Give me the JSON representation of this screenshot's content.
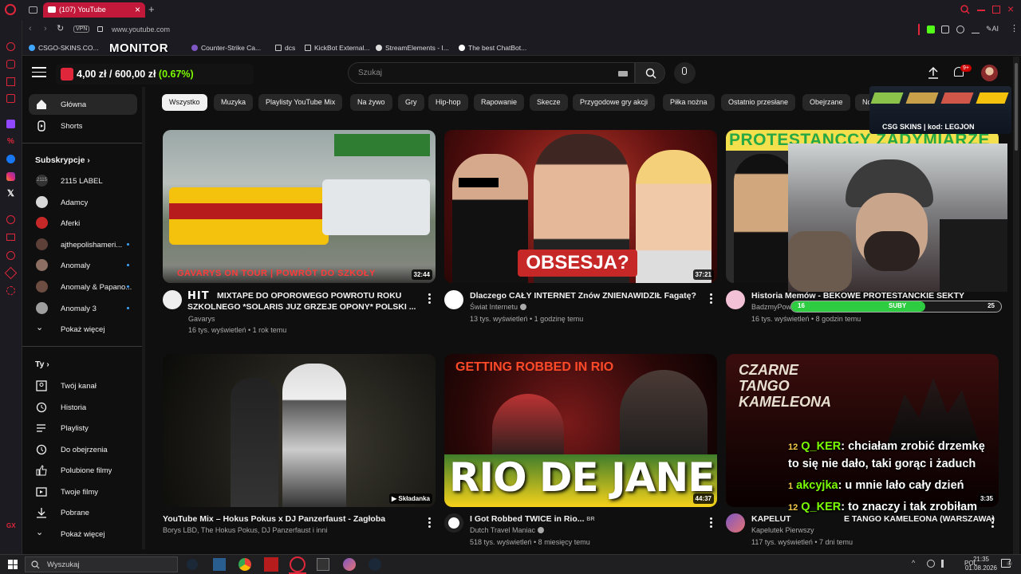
{
  "browser": {
    "tab_title": "(107) YouTube",
    "url": "www.youtube.com",
    "vpn_label": "VPN",
    "ai_label": "AI",
    "bookmarks": [
      "CSGO-SKINS.CO...",
      "Counter-Strike Ca...",
      "dcs",
      "KickBot External...",
      "StreamElements - I...",
      "The best ChatBot..."
    ]
  },
  "overlay": {
    "monitor_label": "MONITOR",
    "goal_current": "4,00 zł",
    "goal_sep": "/",
    "goal_target": "600,00 zł",
    "goal_percent": "(0.67%)",
    "promo_text": "CSG  SKINS | kod: LEGJON",
    "sub_bar_label": "SUBY",
    "sub_bar_current": "16",
    "sub_bar_target": "25",
    "sub_bar_progress": 0.64,
    "chat": [
      {
        "user": "Q_KER",
        "msg": ": chciałam zrobić drzemkę"
      },
      {
        "user": "",
        "msg": "to się nie dało, taki gorąc i żaduch"
      },
      {
        "user": "akcyjka",
        "msg": ": u mnie lało cały dzień"
      },
      {
        "user": "Q_KER",
        "msg": ": to znaczy i tak zrobiłam"
      }
    ],
    "chat_badges": [
      "12",
      "1",
      "1",
      "12"
    ]
  },
  "youtube": {
    "search_placeholder": "Szukaj",
    "notif_count": "9+",
    "guide": {
      "main": [
        {
          "label": "Główna",
          "icon": "home-icon"
        },
        {
          "label": "Shorts",
          "icon": "shorts-icon"
        }
      ],
      "subs_header": "Subskrypcje",
      "subs": [
        {
          "label": "2115 LABEL",
          "color": "#333333",
          "dot": false
        },
        {
          "label": "Adamcy",
          "color": "#d8d8d8",
          "dot": false
        },
        {
          "label": "Aferki",
          "color": "#c62828",
          "dot": false
        },
        {
          "label": "ajthepolishameri...",
          "color": "#5d4037",
          "dot": true
        },
        {
          "label": "Anomaly",
          "color": "#8d6e63",
          "dot": true
        },
        {
          "label": "Anomaly & Papano...",
          "color": "#6d4c41",
          "dot": true
        },
        {
          "label": "Anomaly 3",
          "color": "#9e9e9e",
          "dot": true
        }
      ],
      "subs_more": "Pokaż więcej",
      "you_header": "Ty",
      "you": [
        {
          "label": "Twój kanał",
          "icon": "channel-icon"
        },
        {
          "label": "Historia",
          "icon": "history-icon"
        },
        {
          "label": "Playlisty",
          "icon": "playlist-icon"
        },
        {
          "label": "Do obejrzenia",
          "icon": "watch-later-icon"
        },
        {
          "label": "Polubione filmy",
          "icon": "like-icon"
        },
        {
          "label": "Twoje filmy",
          "icon": "your-videos-icon"
        },
        {
          "label": "Pobrane",
          "icon": "download-icon"
        }
      ],
      "you_more": "Pokaż więcej"
    },
    "chips": [
      "Wszystko",
      "Muzyka",
      "Playlisty YouTube Mix",
      "Na żywo",
      "Gry",
      "Hip-hop",
      "Rapowanie",
      "Skecze",
      "Przygodowe gry akcji",
      "Piłka nożna",
      "Ostatnio przesłane",
      "Obejrzane",
      "No"
    ],
    "videos": [
      {
        "title_1": "MIXTAPE DO OPOROWEGO POWROTU ROKU",
        "title_2": "SZKOLNEGO *SOLARIS JUZ GRZEJE OPONY* POLSKI ...",
        "channel": "Gavarys",
        "meta": "16 tys. wyświetleń • 1 rok temu",
        "duration": "32:44",
        "thumb_text": "GAVARYS ON TOUR | POWRÓT DO SZKOŁY",
        "hit": "HIT"
      },
      {
        "title_1": "Dlaczego CAŁY INTERNET Znów ZNIENAWIDZIŁ Fagatę?",
        "title_2": "",
        "channel": "Świat Internetu",
        "meta": "13 tys. wyświetleń • 1 godzinę temu",
        "duration": "37:21",
        "thumb_text": "OBSESJA?"
      },
      {
        "title_1": "Historia Memów - BEKOWE PROTESTANCKIE SEKTY",
        "title_2": "",
        "channel": "BadzmyPow",
        "meta": "16 tys. wyświetleń • 8 godzin temu",
        "duration": "",
        "thumb_text": "PROTESTANCCY ZADYMIARZE"
      },
      {
        "title_1": "YouTube Mix – Hokus Pokus x DJ Panzerfaust - Zagłoba",
        "title_2": "",
        "channel": "Borys LBD, The Hokus Pokus, DJ Panzerfaust i inni",
        "meta": "",
        "duration": "Składanka"
      },
      {
        "title_1": "I Got Robbed TWICE in Rio...",
        "title_2": "",
        "channel": "Dutch Travel Maniac",
        "meta": "518 tys. wyświetleń • 8 miesięcy temu",
        "duration": "44:37",
        "thumb_top": "GETTING ROBBED IN RIO",
        "thumb_text": "RIO DE JANEIRO",
        "flag": "BR"
      },
      {
        "title_1": "KAPELUT",
        "title_2": "",
        "title_tail": "E TANGO KAMELEONA (WARSZAWA)",
        "channel": "Kapelutek Pierwszy",
        "meta": "117 tys. wyświetleń • 7 dni temu",
        "duration": "3:35",
        "thumb_text": "CZARNE TANGO KAMELEONA"
      }
    ]
  },
  "taskbar": {
    "search_placeholder": "Wyszukaj",
    "lang": "POL",
    "time": "21:35",
    "date": "01.08.2026",
    "notif": "1"
  },
  "colors": {
    "opera_red": "#e0263a",
    "yt_bg": "#0f0f0f",
    "chip_bg": "#272727",
    "accent_green": "#7CFC00"
  }
}
